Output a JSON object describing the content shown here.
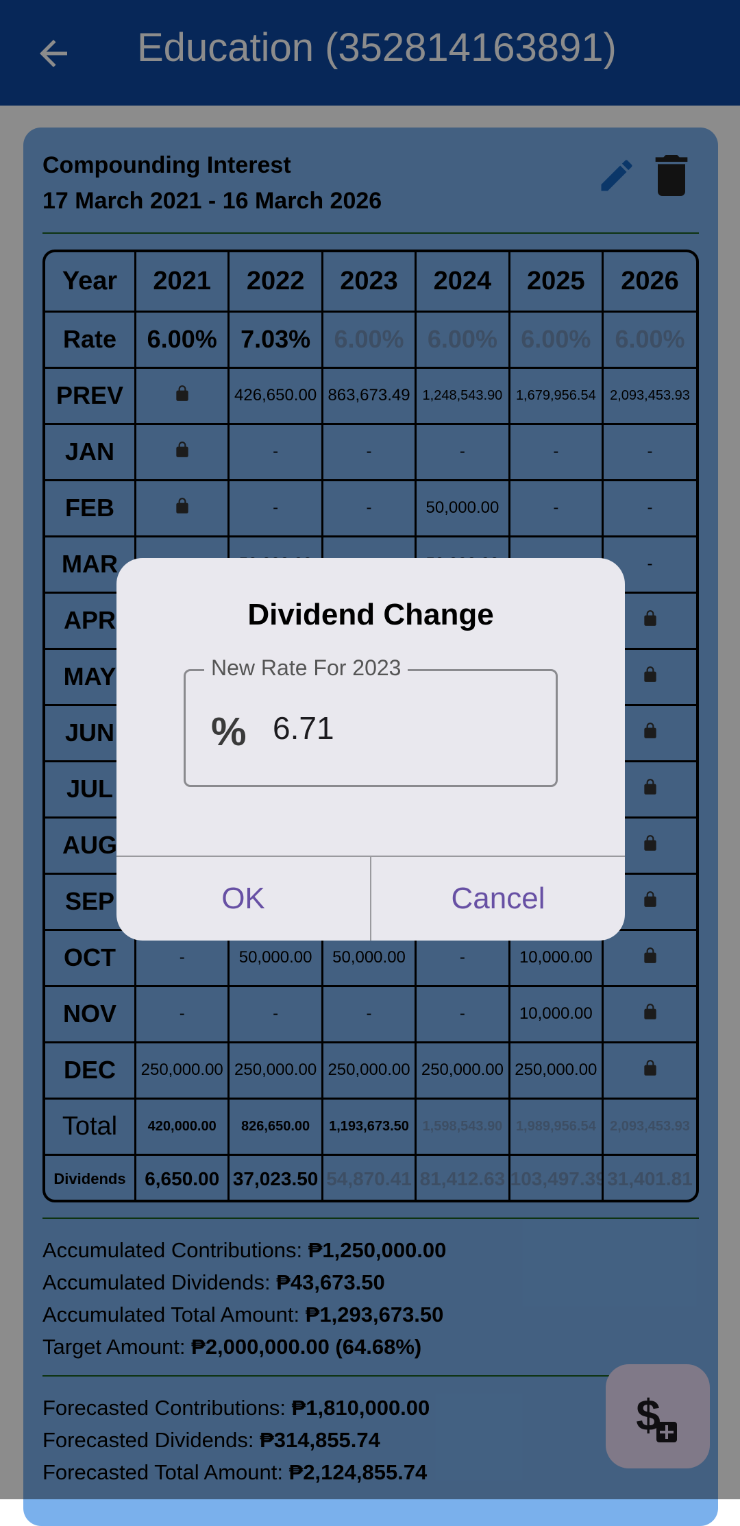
{
  "app_bar": {
    "title": "Education (352814163891)"
  },
  "card": {
    "title": "Compounding Interest",
    "dates": "17 March 2021 - 16 March 2026"
  },
  "table": {
    "header": [
      "Year",
      "2021",
      "2022",
      "2023",
      "2024",
      "2025",
      "2026"
    ],
    "rate": {
      "label": "Rate",
      "values": [
        "6.00%",
        "7.03%",
        "6.00%",
        "6.00%",
        "6.00%",
        "6.00%"
      ]
    },
    "prev": {
      "label": "PREV",
      "values": [
        "",
        "426,650.00",
        "863,673.49",
        "1,248,543.90",
        "1,679,956.54",
        "2,093,453.93"
      ]
    },
    "months": [
      {
        "label": "JAN",
        "values": [
          "",
          "-",
          "-",
          "-",
          "-",
          "-"
        ]
      },
      {
        "label": "FEB",
        "values": [
          "",
          "-",
          "-",
          "50,000.00",
          "-",
          "-"
        ]
      },
      {
        "label": "MAR",
        "values": [
          "-",
          "50,000.00",
          "-",
          "50,000.00",
          "-",
          "-"
        ]
      },
      {
        "label": "APR",
        "values": [
          "",
          "",
          "",
          "",
          "",
          ""
        ]
      },
      {
        "label": "MAY",
        "values": [
          "",
          "",
          "",
          "",
          "",
          ""
        ]
      },
      {
        "label": "JUN",
        "values": [
          "",
          "",
          "",
          "",
          "",
          ""
        ]
      },
      {
        "label": "JUL",
        "values": [
          "",
          "",
          "",
          "",
          "",
          ""
        ]
      },
      {
        "label": "AUG",
        "values": [
          "",
          "",
          "",
          "",
          "",
          ""
        ]
      },
      {
        "label": "SEP",
        "values": [
          "",
          "",
          "",
          "",
          "",
          ""
        ]
      },
      {
        "label": "OCT",
        "values": [
          "-",
          "50,000.00",
          "50,000.00",
          "-",
          "10,000.00",
          ""
        ]
      },
      {
        "label": "NOV",
        "values": [
          "-",
          "-",
          "-",
          "-",
          "10,000.00",
          ""
        ]
      },
      {
        "label": "DEC",
        "values": [
          "250,000.00",
          "250,000.00",
          "250,000.00",
          "250,000.00",
          "250,000.00",
          ""
        ]
      }
    ],
    "total": {
      "label": "Total",
      "values": [
        "420,000.00",
        "826,650.00",
        "1,193,673.50",
        "1,598,543.90",
        "1,989,956.54",
        "2,093,453.93"
      ]
    },
    "dividends": {
      "label": "Dividends",
      "values": [
        "6,650.00",
        "37,023.50",
        "54,870.41",
        "81,412.63",
        "103,497.39",
        "31,401.81"
      ]
    }
  },
  "summary": {
    "acc_contrib_label": "Accumulated Contributions:",
    "acc_contrib_value": "₱1,250,000.00",
    "acc_div_label": "Accumulated Dividends:",
    "acc_div_value": "₱43,673.50",
    "acc_total_label": "Accumulated Total Amount:",
    "acc_total_value": "₱1,293,673.50",
    "target_label": "Target Amount:",
    "target_value": "₱2,000,000.00 (64.68%)",
    "fc_contrib_label": "Forecasted Contributions:",
    "fc_contrib_value": "₱1,810,000.00",
    "fc_div_label": "Forecasted Dividends:",
    "fc_div_value": "₱314,855.74",
    "fc_total_label": "Forecasted Total Amount:",
    "fc_total_value": "₱2,124,855.74"
  },
  "dialog": {
    "title": "Dividend Change",
    "field_label": "New Rate For 2023",
    "field_prefix": "%",
    "field_value": "6.71",
    "ok_label": "OK",
    "cancel_label": "Cancel"
  },
  "icons": {
    "back": "arrow-back-icon",
    "edit": "pencil-icon",
    "delete": "trash-icon",
    "lock": "lock-icon",
    "fab": "add-money-icon"
  },
  "colors": {
    "app_bar": "#0d47a1",
    "card": "#7ab0ec",
    "total_green": "#1b5e20",
    "accent": "#6750a4",
    "fab": "#eadcf7"
  }
}
